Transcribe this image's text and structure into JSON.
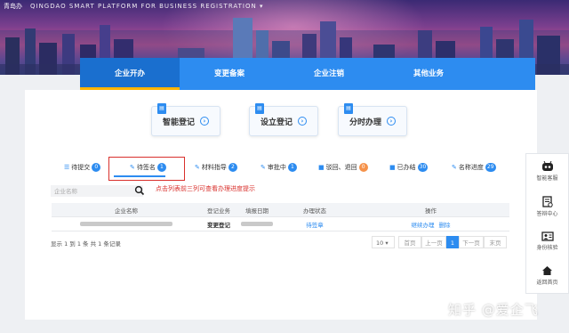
{
  "banner": {
    "logo_text": "青岛办",
    "title": "QINGDAO SMART PLATFORM FOR BUSINESS REGISTRATION",
    "title_arrow": "▾"
  },
  "nav": {
    "items": [
      {
        "label": "企业开办",
        "active": true
      },
      {
        "label": "变更备案",
        "active": false
      },
      {
        "label": "企业注销",
        "active": false
      },
      {
        "label": "其他业务",
        "active": false
      }
    ]
  },
  "services": [
    {
      "label": "智能登记",
      "arrow": "›"
    },
    {
      "label": "设立登记",
      "arrow": "›"
    },
    {
      "label": "分时办理",
      "arrow": "›"
    }
  ],
  "tabs": [
    {
      "icon": "☰",
      "label": "待提交",
      "count": "0",
      "color": "#2d8cf0"
    },
    {
      "icon": "✎",
      "label": "待签名",
      "count": "1",
      "color": "#2d8cf0"
    },
    {
      "icon": "✎",
      "label": "材料指导",
      "count": "2",
      "color": "#2d8cf0"
    },
    {
      "icon": "✎",
      "label": "审批中",
      "count": "1",
      "color": "#2d8cf0"
    },
    {
      "icon": "■",
      "label": "驳回、退回",
      "count": "0",
      "color": "#f5924a"
    },
    {
      "icon": "■",
      "label": "已办结",
      "count": "30",
      "color": "#2d8cf0"
    },
    {
      "icon": "✎",
      "label": "名称进度",
      "count": "29",
      "color": "#2d8cf0"
    }
  ],
  "search": {
    "placeholder": "企业名称",
    "hint": "点击列表前三列可查看办理进度提示"
  },
  "table": {
    "headers": [
      "企业名称",
      "登记业务",
      "填报日期",
      "办理状态",
      "操作"
    ],
    "rows": [
      {
        "reg_type": "变更登记",
        "status": "待签章",
        "action_continue": "继续办理",
        "action_delete": "删除"
      }
    ]
  },
  "records": "显示 1 到 1 条 共 1 条记录",
  "pagination": {
    "page_size": "10 ▾",
    "first": "首页",
    "prev": "上一页",
    "current": "1",
    "next": "下一页",
    "last": "末页"
  },
  "side_tools": [
    {
      "label": "智能客服",
      "icon": "robot-icon"
    },
    {
      "label": "答辩中心",
      "icon": "document-icon"
    },
    {
      "label": "身份核验",
      "icon": "id-card-icon"
    },
    {
      "label": "返回首页",
      "icon": "home-icon"
    }
  ],
  "watermark": "知乎 @爱企飞",
  "colors": {
    "primary": "#2d8cf0",
    "accent": "#ffb400",
    "alert": "#d9302c"
  }
}
